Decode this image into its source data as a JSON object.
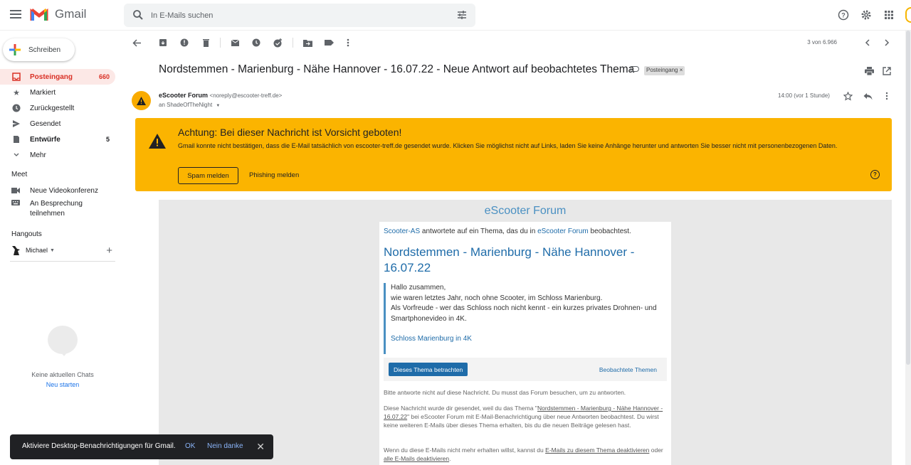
{
  "app": {
    "name": "Gmail"
  },
  "search": {
    "placeholder": "In E-Mails suchen"
  },
  "compose": {
    "label": "Schreiben"
  },
  "nav": [
    {
      "label": "Posteingang",
      "count": "660",
      "icon": "inbox-icon"
    },
    {
      "label": "Markiert",
      "count": "",
      "icon": "star-icon"
    },
    {
      "label": "Zurückgestellt",
      "count": "",
      "icon": "clock-icon"
    },
    {
      "label": "Gesendet",
      "count": "",
      "icon": "send-icon"
    },
    {
      "label": "Entwürfe",
      "count": "5",
      "icon": "draft-icon"
    },
    {
      "label": "Mehr",
      "count": "",
      "icon": "chevron-down-icon"
    }
  ],
  "meet": {
    "heading": "Meet",
    "new_meeting": "Neue Videokonferenz",
    "join_1": "An Besprechung",
    "join_2": "teilnehmen"
  },
  "hangouts": {
    "heading": "Hangouts",
    "user": "Michael",
    "no_chats": "Keine aktuellen Chats",
    "start_new": "Neu starten"
  },
  "pager": {
    "text": "3 von 6.966"
  },
  "message": {
    "subject": "Nordstemmen - Marienburg - Nähe Hannover - 16.07.22 - Neue Antwort auf beobachtetes Thema",
    "label": "Posteingang ×",
    "sender_name": "eScooter Forum",
    "sender_addr": "<noreply@escooter-treff.de>",
    "to": "an ShadeOfTheNight",
    "time": "14:00 (vor 1 Stunde)"
  },
  "warning": {
    "title": "Achtung: Bei dieser Nachricht ist Vorsicht geboten!",
    "text": "Gmail konnte nicht bestätigen, dass die E-Mail tatsächlich von escooter-treff.de gesendet wurde. Klicken Sie möglichst nicht auf Links, laden Sie keine Anhänge herunter und antworten Sie besser nicht mit personenbezogenen Daten.",
    "spam_btn": "Spam melden",
    "phishing_btn": "Phishing melden"
  },
  "forum": {
    "title": "eScooter Forum",
    "intro_user": "Scooter-AS",
    "intro_mid": " antwortete auf ein Thema, das du in ",
    "intro_forum": "eScooter Forum",
    "intro_end": " beobachtest.",
    "topic": "Nordstemmen - Marienburg - Nähe Hannover - 16.07.22",
    "quote_l1": "Hallo zusammen,",
    "quote_l2": "wie waren letztes Jahr, noch ohne Scooter, im Schloss Marienburg.",
    "quote_l3": "Als Vorfreude - wer das Schloss noch nicht kennt - ein kurzes privates Drohnen- und Smartphonevideo in 4K.",
    "quote_link": "Schloss Marienburg in 4K",
    "view_btn": "Dieses Thema betrachten",
    "watched": "Beobachtete Themen",
    "note1": "Bitte antworte nicht auf diese Nachricht. Du musst das Forum besuchen, um zu antworten.",
    "note2_a": "Diese Nachricht wurde dir gesendet, weil du das Thema \"",
    "note2_link": "Nordstemmen - Marienburg - Nähe Hannover - 16.07.22",
    "note2_b": "\" bei eScooter Forum mit E-Mail-Benachrichtigung über neue Antworten beobachtest. Du wirst keine weiteren E-Mails über dieses Thema erhalten, bis du die neuen Beiträge gelesen hast.",
    "note3_a": "Wenn du diese E-Mails nicht mehr erhalten willst, kannst du ",
    "note3_link1": "E-Mails zu diesem Thema deaktivieren",
    "note3_b": " oder ",
    "note3_link2": "alle E-Mails deaktivieren",
    "note3_c": "."
  },
  "toast": {
    "text": "Aktiviere Desktop-Benachrichtigungen für Gmail.",
    "ok": "OK",
    "no": "Nein danke"
  }
}
